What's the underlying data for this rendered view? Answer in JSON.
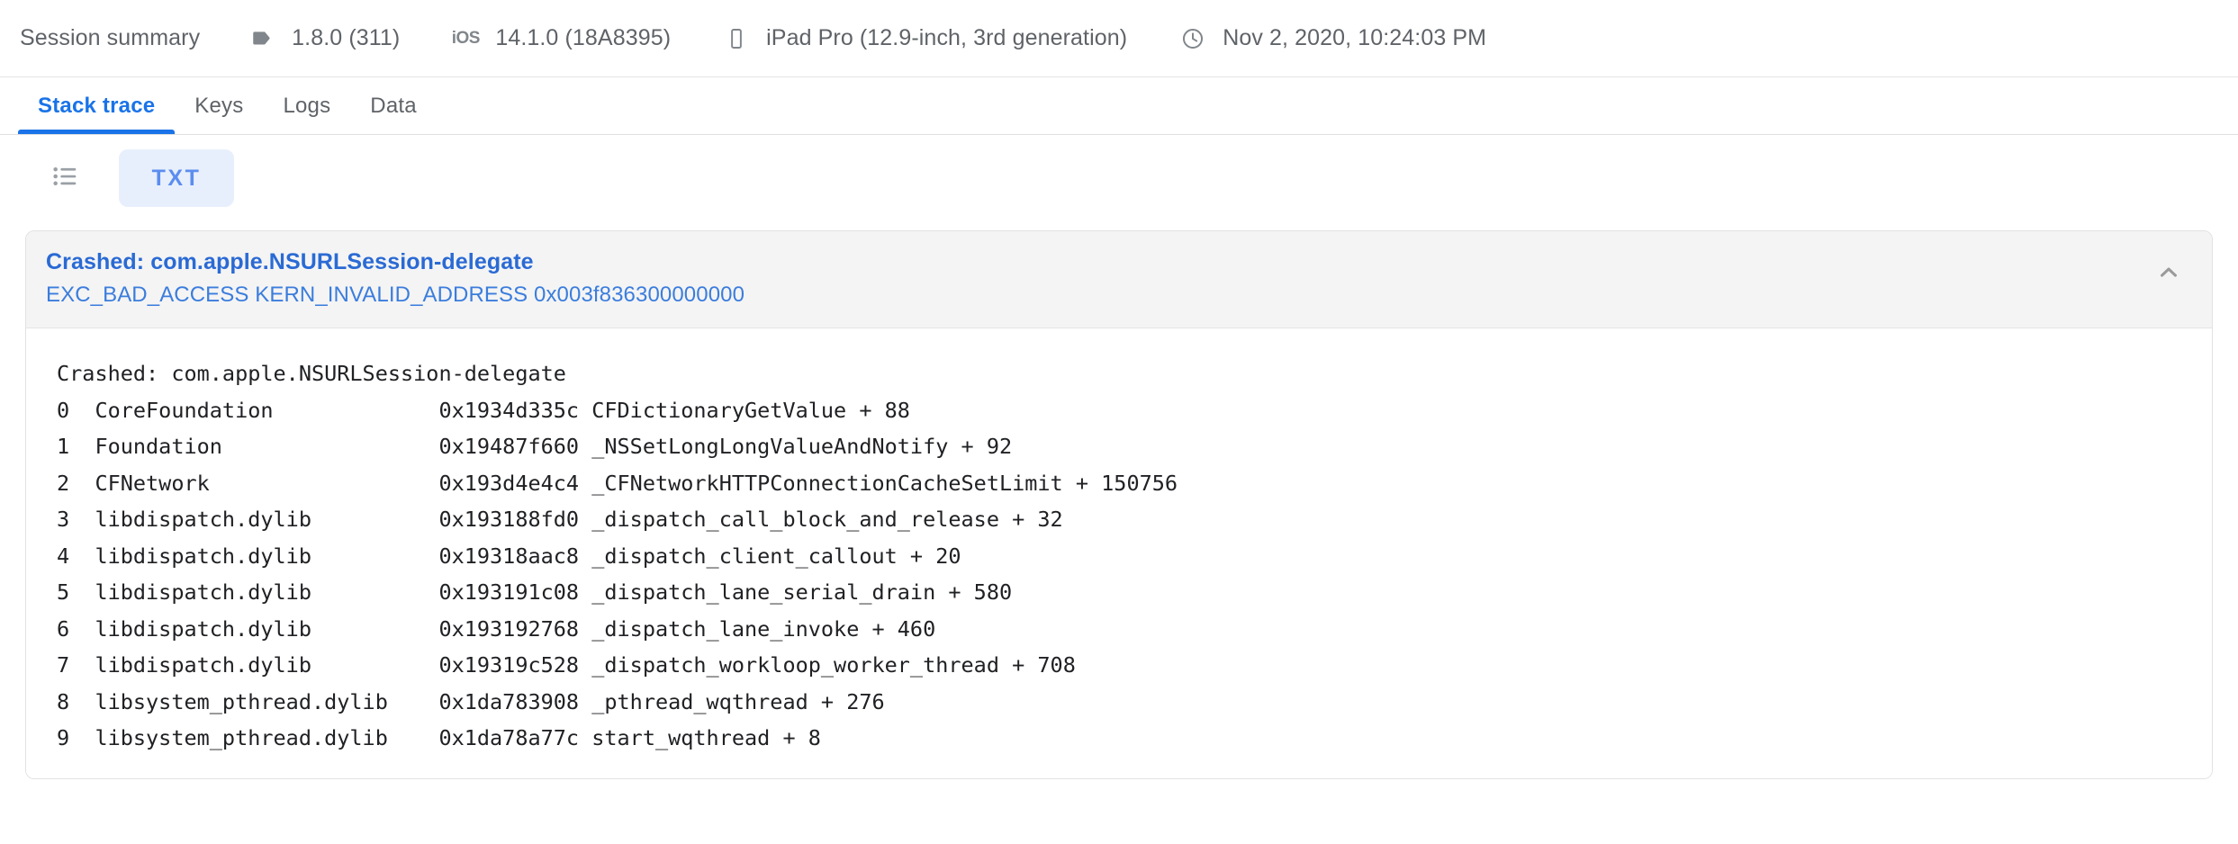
{
  "summary": {
    "title": "Session summary",
    "items": [
      {
        "icon": "app-version-tag-icon",
        "text": "1.8.0 (311)"
      },
      {
        "icon": "ios-logo-icon",
        "glyph": "iOS",
        "text": "14.1.0 (18A8395)"
      },
      {
        "icon": "mobile-device-icon",
        "text": "iPad Pro (12.9-inch, 3rd generation)"
      },
      {
        "icon": "clock-icon",
        "text": "Nov 2, 2020, 10:24:03 PM"
      }
    ]
  },
  "tabs": [
    {
      "label": "Stack trace",
      "active": true
    },
    {
      "label": "Keys",
      "active": false
    },
    {
      "label": "Logs",
      "active": false
    },
    {
      "label": "Data",
      "active": false
    }
  ],
  "toolbar": {
    "list_view_icon": "list-view-icon",
    "txt_label": "TXT"
  },
  "crash": {
    "title": "Crashed: com.apple.NSURLSession-delegate",
    "subtitle": "EXC_BAD_ACCESS KERN_INVALID_ADDRESS 0x003f836300000000",
    "collapse_icon": "chevron-up-icon",
    "trace_header": "Crashed: com.apple.NSURLSession-delegate",
    "frames": [
      {
        "index": "0",
        "binary": "CoreFoundation",
        "address": "0x1934d335c",
        "symbol": "CFDictionaryGetValue + 88"
      },
      {
        "index": "1",
        "binary": "Foundation",
        "address": "0x19487f660",
        "symbol": "_NSSetLongLongValueAndNotify + 92"
      },
      {
        "index": "2",
        "binary": "CFNetwork",
        "address": "0x193d4e4c4",
        "symbol": "_CFNetworkHTTPConnectionCacheSetLimit + 150756"
      },
      {
        "index": "3",
        "binary": "libdispatch.dylib",
        "address": "0x193188fd0",
        "symbol": "_dispatch_call_block_and_release + 32"
      },
      {
        "index": "4",
        "binary": "libdispatch.dylib",
        "address": "0x19318aac8",
        "symbol": "_dispatch_client_callout + 20"
      },
      {
        "index": "5",
        "binary": "libdispatch.dylib",
        "address": "0x193191c08",
        "symbol": "_dispatch_lane_serial_drain + 580"
      },
      {
        "index": "6",
        "binary": "libdispatch.dylib",
        "address": "0x193192768",
        "symbol": "_dispatch_lane_invoke + 460"
      },
      {
        "index": "7",
        "binary": "libdispatch.dylib",
        "address": "0x19319c528",
        "symbol": "_dispatch_workloop_worker_thread + 708"
      },
      {
        "index": "8",
        "binary": "libsystem_pthread.dylib",
        "address": "0x1da783908",
        "symbol": "_pthread_wqthread + 276"
      },
      {
        "index": "9",
        "binary": "libsystem_pthread.dylib",
        "address": "0x1da78a77c",
        "symbol": "start_wqthread + 8"
      }
    ]
  },
  "colors": {
    "accent": "#1a73e8",
    "link": "#2a6ad4",
    "sublink": "#3b7ddd",
    "muted": "#5f6368",
    "txt_button_bg": "#e8effc",
    "txt_button_fg": "#5b8def",
    "panel_header_bg": "#f4f4f4"
  }
}
